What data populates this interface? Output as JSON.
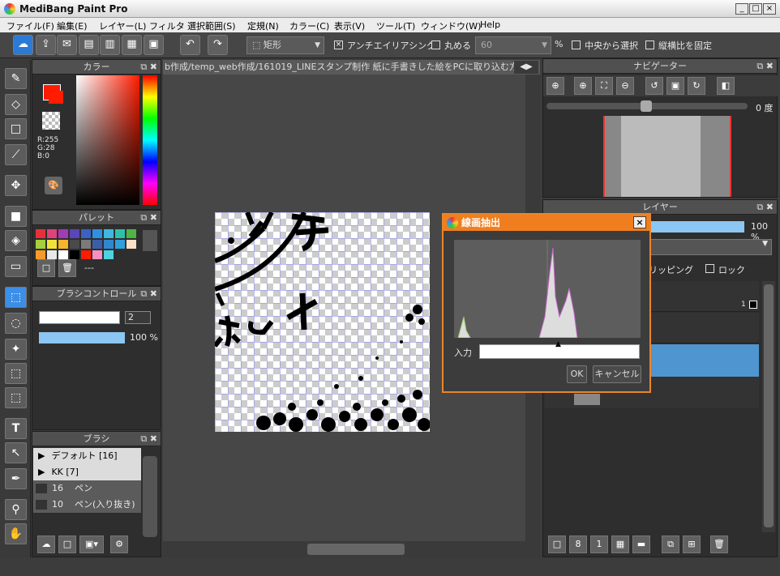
{
  "window": {
    "title": "MediBang Paint Pro",
    "min": "_",
    "max": "□",
    "close": "×"
  },
  "menu": [
    "ファイル(F)",
    "編集(E)",
    "レイヤー(L)",
    "フィルタ",
    "選択範囲(S)",
    "定規(N)",
    "カラー(C)",
    "表示(V)",
    "ツール(T)",
    "ウィンドウ(W)",
    "Help"
  ],
  "toolbar": {
    "shape_select": "矩形",
    "antialias_label": "アンチエイリアシング",
    "round_label": "丸める",
    "round_value": "60",
    "percent": "%",
    "center_label": "中央から選択",
    "aspect_label": "縦横比を固定"
  },
  "color_panel": {
    "title": "カラー",
    "r": "R:255",
    "g": "G:28",
    "b": "B:0",
    "fg": "#ff1c00"
  },
  "palette_panel": {
    "title": "パレット",
    "name": "---"
  },
  "brush_control": {
    "title": "ブラシコントロール",
    "size": "2",
    "opacity": "100 %"
  },
  "brush_panel": {
    "title": "ブラシ",
    "items": [
      {
        "label": "デフォルト [16]",
        "marker": "▶"
      },
      {
        "label": "KK [7]",
        "marker": "▶"
      },
      {
        "label": "ペン",
        "num": "16"
      },
      {
        "label": "ペン(入り抜き)",
        "num": "10"
      }
    ]
  },
  "canvas": {
    "tab": "b作成/temp_web作成/161019_LINEスタンプ制作 紙に手書きした絵をPCに取り込む方法"
  },
  "navigator": {
    "title": "ナビゲーター",
    "angle": "0 度"
  },
  "layer_panel": {
    "title": "レイヤー",
    "opacity": "100 %",
    "clipping": "リッピング",
    "lock": "ロック",
    "layer_num": "1"
  },
  "dialog": {
    "title": "線画抽出",
    "input_label": "入力",
    "ok": "OK",
    "cancel": "キャンセル"
  }
}
